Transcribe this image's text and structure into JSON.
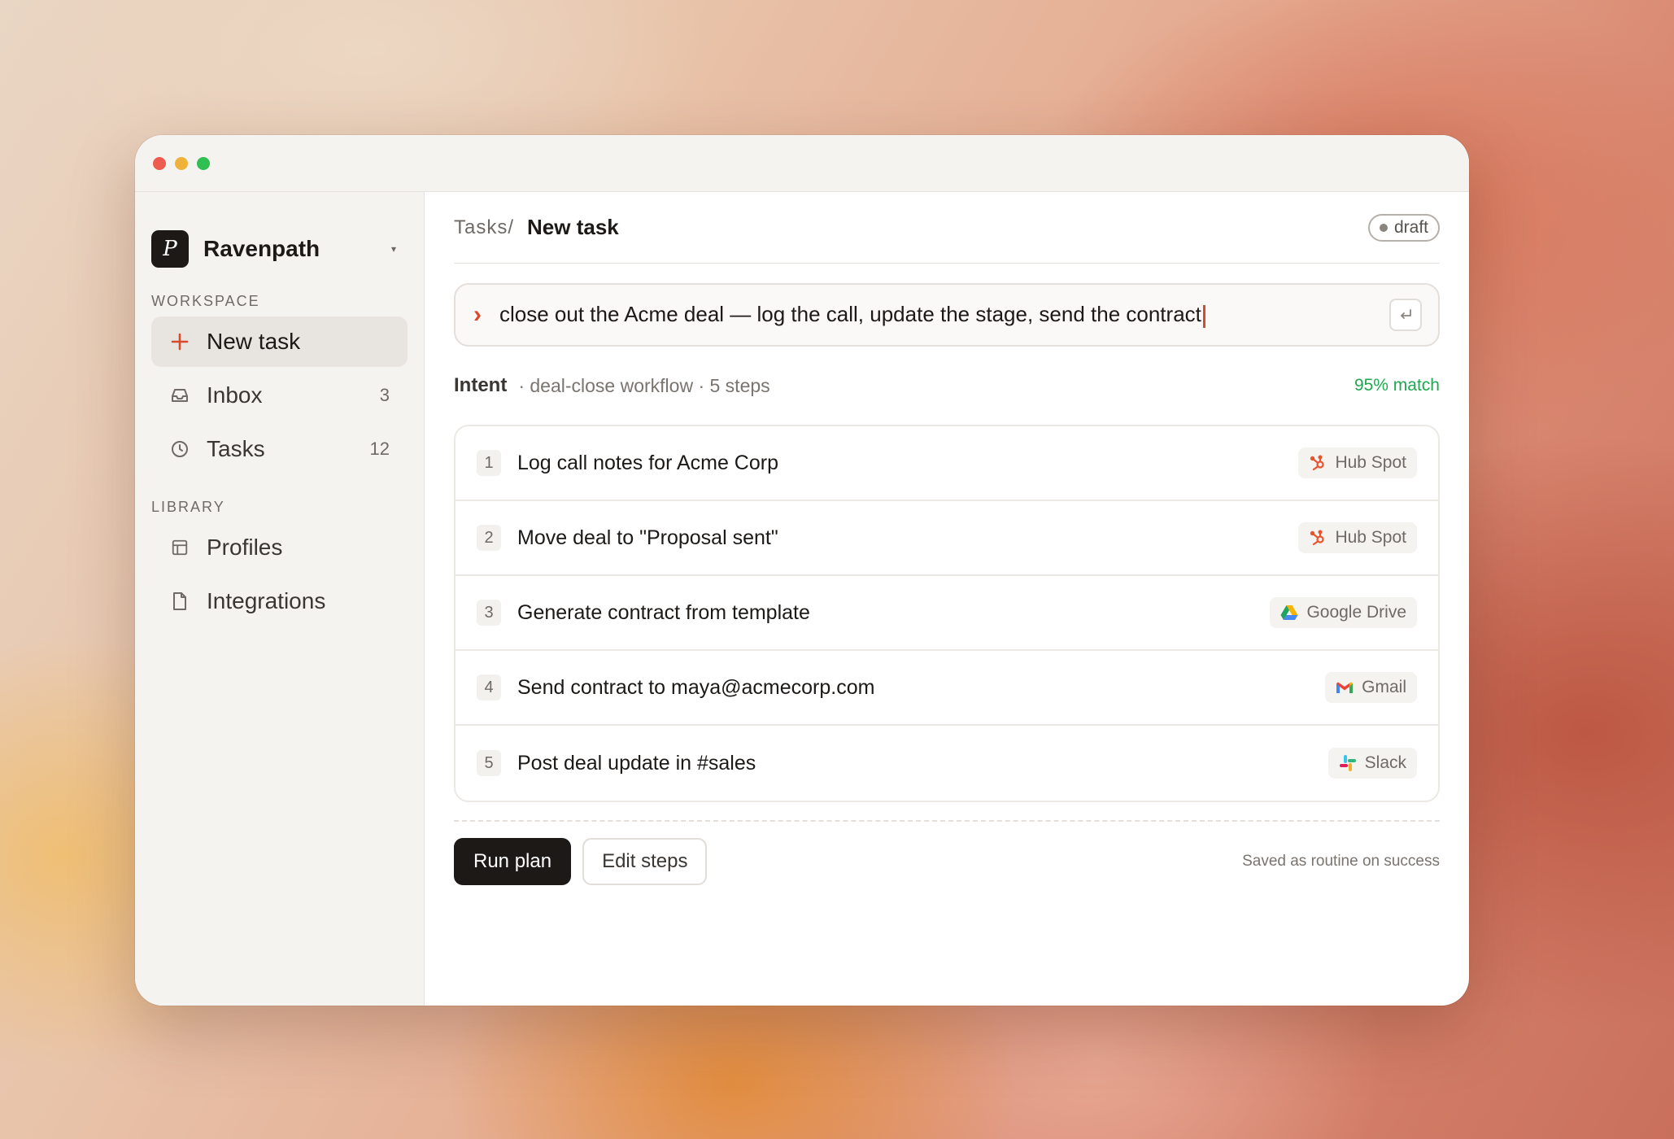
{
  "window": {
    "controls": [
      "close",
      "minimize",
      "zoom"
    ]
  },
  "sidebar": {
    "org": {
      "logo_letter": "P",
      "name": "Ravenpath",
      "caret": "▾"
    },
    "workspace_label": "WORKSPACE",
    "workspace_items": [
      {
        "label": "New task",
        "icon": "plus-icon",
        "count": "",
        "active": true
      },
      {
        "label": "Inbox",
        "icon": "inbox-icon",
        "count": "3"
      },
      {
        "label": "Tasks",
        "icon": "clock-icon",
        "count": "12"
      }
    ],
    "library_label": "LIBRARY",
    "library_items": [
      {
        "label": "Profiles",
        "icon": "table-icon"
      },
      {
        "label": "Integrations",
        "icon": "document-icon"
      }
    ]
  },
  "header": {
    "breadcrumb": "Tasks/",
    "title": "New task",
    "status": "draft"
  },
  "prompt": {
    "chevron": "›",
    "text": "close out the Acme deal — log the call, update the stage, send the contract",
    "enter_icon": "enter-key-icon"
  },
  "intent": {
    "label": "Intent",
    "detail": "· deal-close workflow · 5 steps",
    "match": "95% match"
  },
  "steps": [
    {
      "num": "1",
      "label": "Log call notes for Acme Corp",
      "tool": "Hub Spot",
      "tool_icon": "hubspot-icon"
    },
    {
      "num": "2",
      "label": "Move deal to \"Proposal sent\"",
      "tool": "Hub Spot",
      "tool_icon": "hubspot-icon"
    },
    {
      "num": "3",
      "label": "Generate contract from template",
      "tool": "Google Drive",
      "tool_icon": "google-drive-icon"
    },
    {
      "num": "4",
      "label": "Send contract to maya@acmecorp.com",
      "tool": "Gmail",
      "tool_icon": "gmail-icon"
    },
    {
      "num": "5",
      "label": "Post deal update in #sales",
      "tool": "Slack",
      "tool_icon": "slack-icon"
    }
  ],
  "actions": {
    "run_label": "Run plan",
    "edit_label": "Edit steps",
    "footnote": "Saved as routine on success"
  },
  "colors": {
    "accent": "#d84a2c",
    "match_green": "#1ea84f",
    "primary_button": "#1c1917"
  }
}
